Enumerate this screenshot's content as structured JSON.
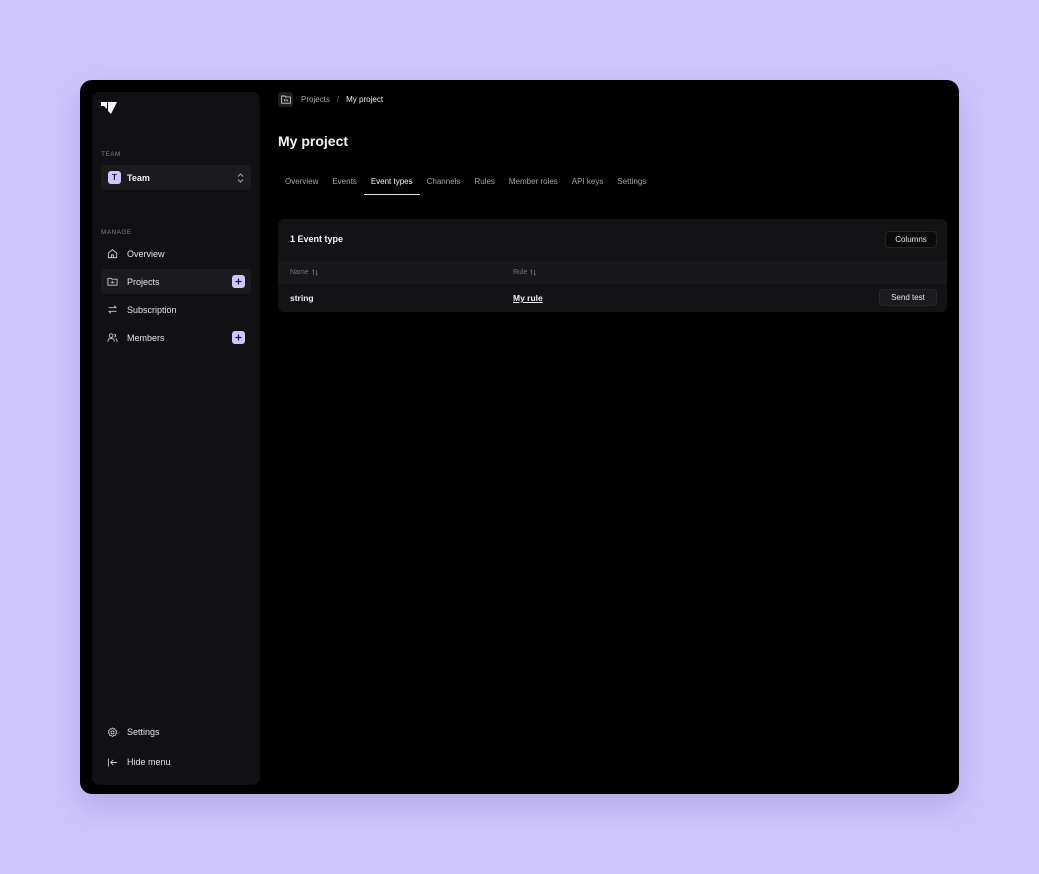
{
  "sidebar": {
    "team_section_label": "TEAM",
    "team_select": {
      "avatar_letter": "T",
      "label": "Team"
    },
    "manage_section_label": "MANAGE",
    "items": [
      {
        "label": "Overview",
        "icon": "home-icon"
      },
      {
        "label": "Projects",
        "icon": "folder-icon",
        "active": true,
        "has_add": true
      },
      {
        "label": "Subscription",
        "icon": "arrows-swap-icon"
      },
      {
        "label": "Members",
        "icon": "users-icon",
        "has_add": true
      }
    ],
    "bottom": {
      "settings_label": "Settings",
      "hide_menu_label": "Hide menu"
    }
  },
  "breadcrumb": {
    "parent": "Projects",
    "separator": "/",
    "current": "My project"
  },
  "page_title": "My project",
  "tabs": [
    {
      "label": "Overview"
    },
    {
      "label": "Events"
    },
    {
      "label": "Event types",
      "active": true
    },
    {
      "label": "Channels"
    },
    {
      "label": "Rules"
    },
    {
      "label": "Member roles"
    },
    {
      "label": "API keys"
    },
    {
      "label": "Settings"
    }
  ],
  "card": {
    "title": "1 Event type",
    "columns_button": "Columns",
    "headers": {
      "name": "Name",
      "rule": "Rule"
    },
    "rows": [
      {
        "name": "string",
        "rule": "My rule",
        "action": "Send test"
      }
    ]
  },
  "colors": {
    "background": "#cec5fd",
    "accent": "#cec5fd",
    "window": "#000000",
    "sidebar": "#111113"
  }
}
